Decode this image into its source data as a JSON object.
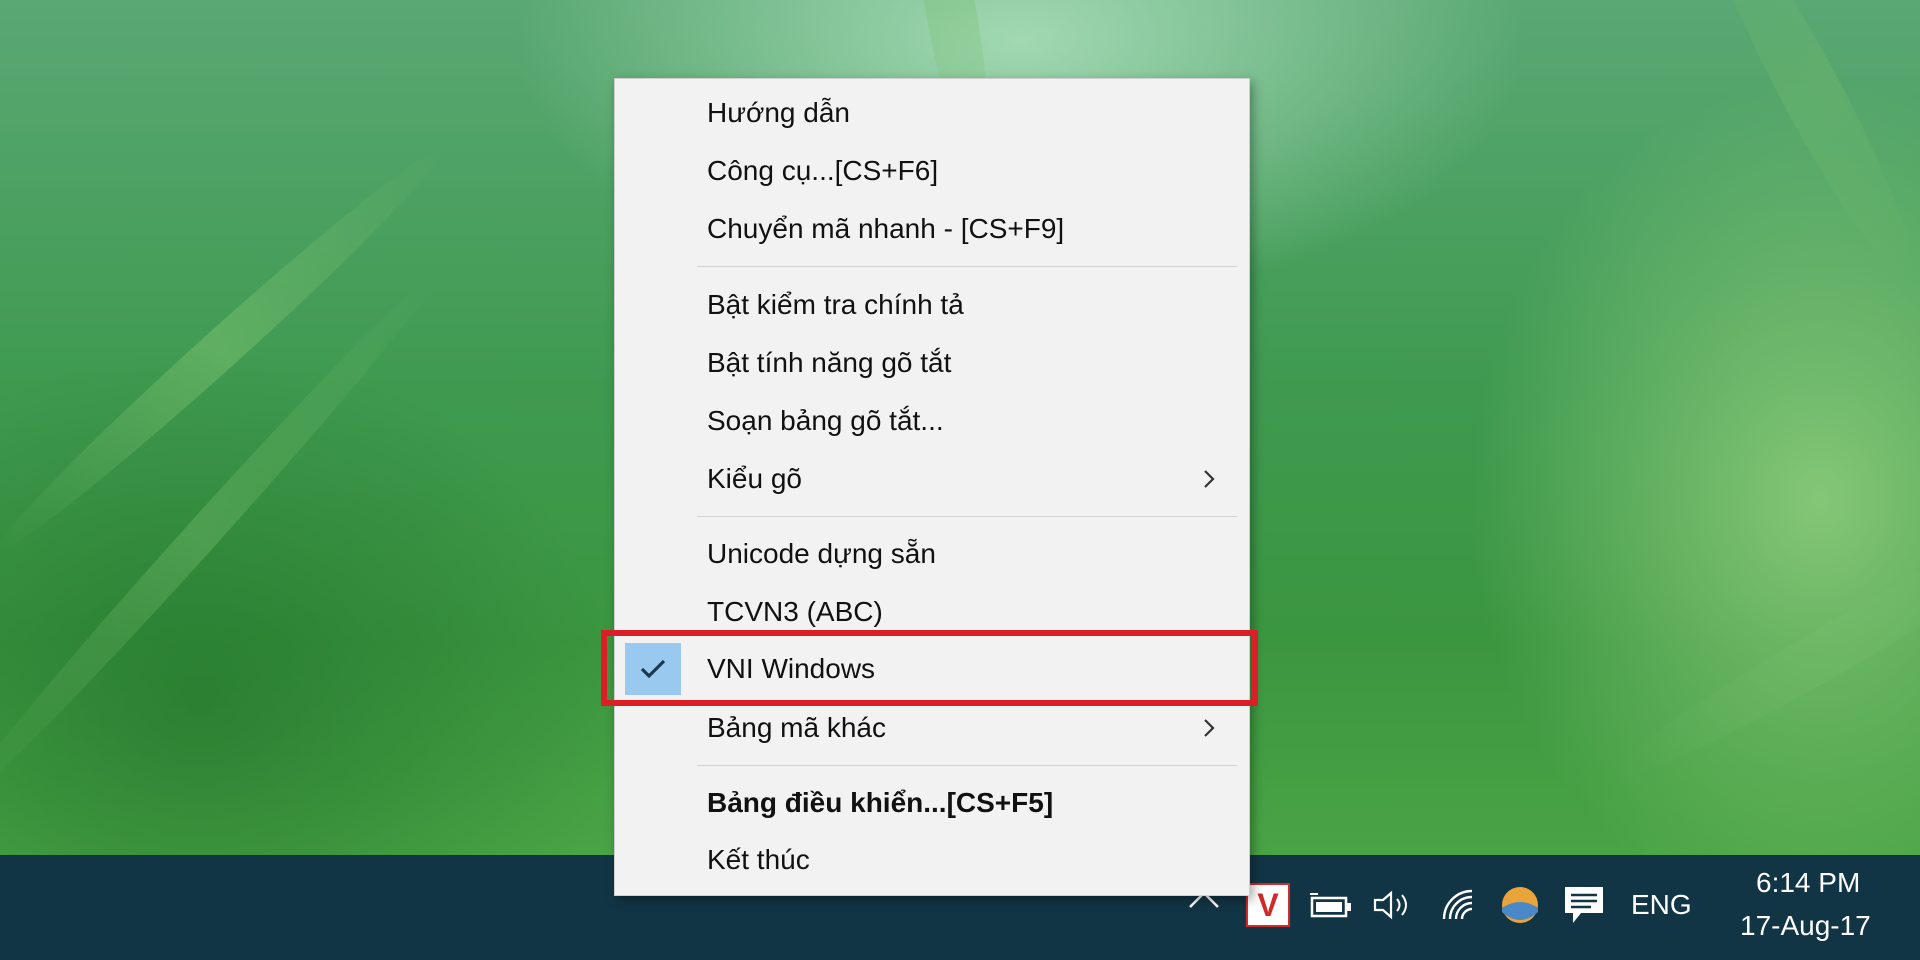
{
  "menu": {
    "items": [
      {
        "label": "Hướng dẫn"
      },
      {
        "label": "Công cụ...[CS+F6]"
      },
      {
        "label": "Chuyển mã nhanh - [CS+F9]"
      },
      {
        "label": "Bật kiểm tra chính tả"
      },
      {
        "label": "Bật tính năng gõ tắt"
      },
      {
        "label": "Soạn bảng gõ tắt..."
      },
      {
        "label": "Kiểu gõ",
        "submenu": true
      },
      {
        "label": "Unicode dựng sẵn"
      },
      {
        "label": "TCVN3 (ABC)"
      },
      {
        "label": "VNI Windows",
        "checked": true,
        "highlighted": true
      },
      {
        "label": "Bảng mã khác",
        "submenu": true
      },
      {
        "label": "Bảng điều khiển...[CS+F5]",
        "bold": true
      },
      {
        "label": "Kết thúc"
      }
    ],
    "check_color": "#99c9ef",
    "highlight_color": "#dc1f26"
  },
  "taskbar": {
    "app_icon_letter": "V",
    "language": "ENG",
    "time": "6:14 PM",
    "date": "17-Aug-17",
    "icons": [
      "chevron-up-icon",
      "vietkey-icon",
      "battery-icon",
      "volume-icon",
      "wifi-icon",
      "weather-icon",
      "notification-icon"
    ]
  }
}
